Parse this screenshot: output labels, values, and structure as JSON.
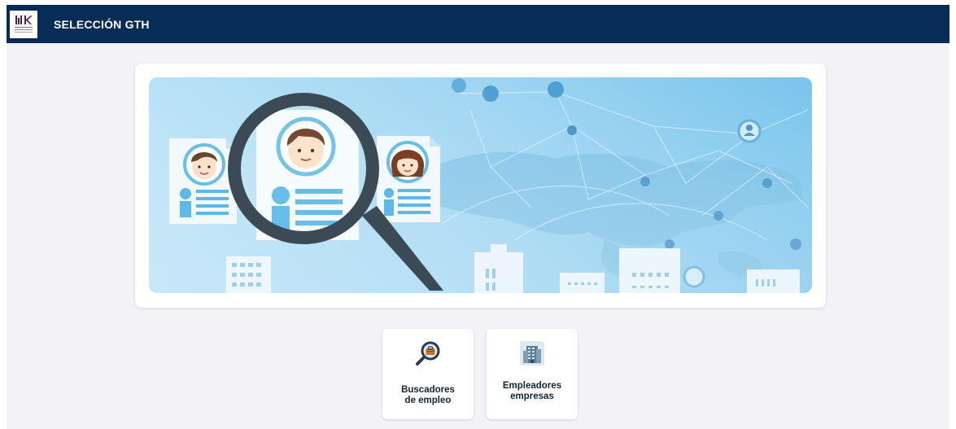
{
  "header": {
    "title": "SELECCIÓN GTH",
    "logo_icon": "institution-logo",
    "background": "#062c57"
  },
  "banner": {
    "illustration": "recruitment-search-banner",
    "colors": {
      "sky": "#aedcf5",
      "accent": "#5bb9ea",
      "lens": "#3c4a55"
    }
  },
  "tiles": [
    {
      "label_line1": "Buscadores",
      "label_line2": "de empleo",
      "icon": "magnifier-briefcase-icon"
    },
    {
      "label_line1": "Empleadores",
      "label_line2": "empresas",
      "icon": "office-building-icon"
    }
  ]
}
